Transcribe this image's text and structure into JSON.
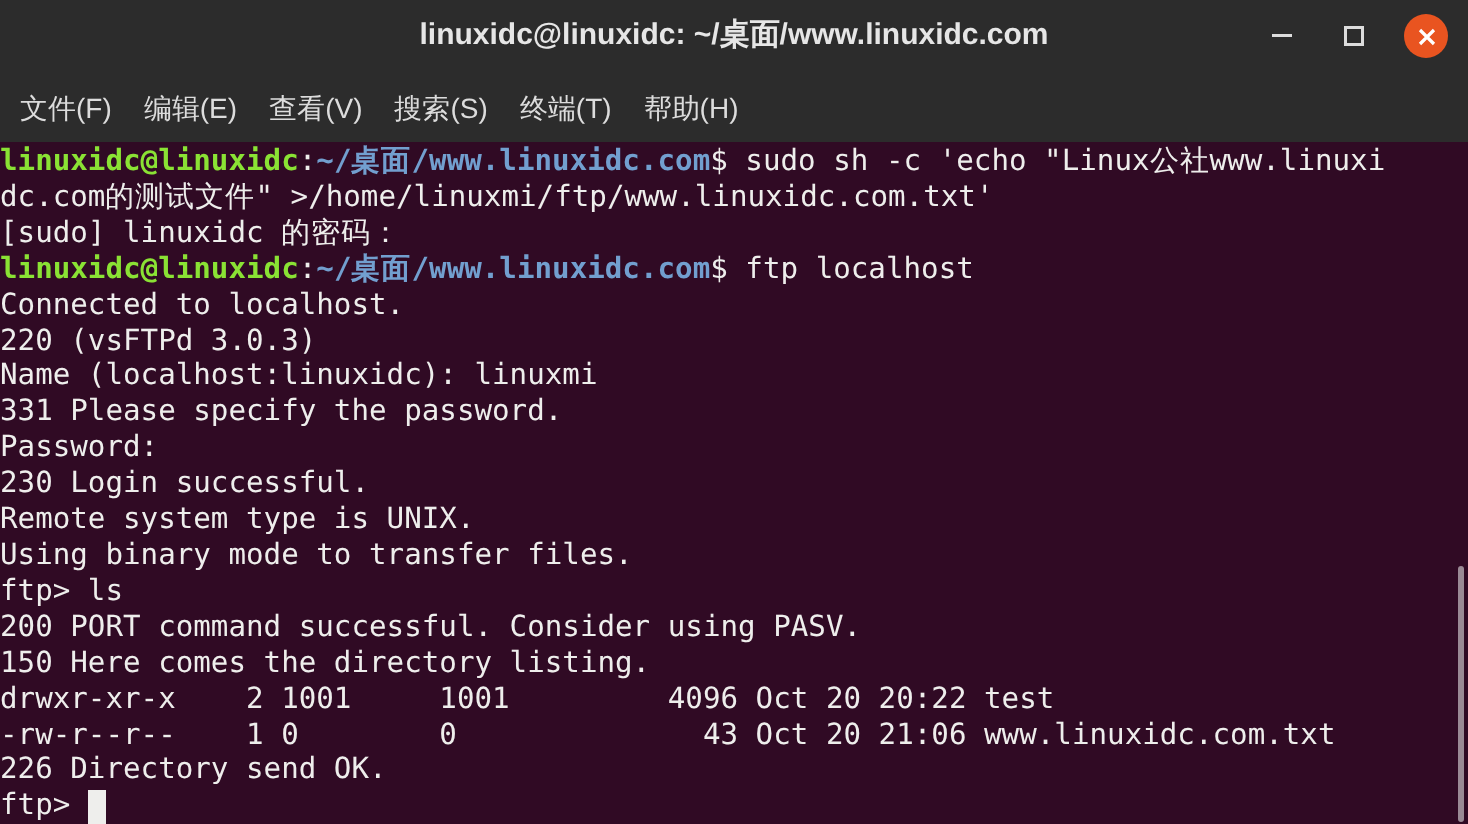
{
  "window": {
    "title": "linuxidc@linuxidc: ~/桌面/www.linuxidc.com"
  },
  "menu": [
    "文件(F)",
    "编辑(E)",
    "查看(V)",
    "搜索(S)",
    "终端(T)",
    "帮助(H)"
  ],
  "terminal": {
    "lines": [
      {
        "kind": "prompt",
        "user": "linuxidc@linuxidc",
        "separator": ":",
        "path": "~/桌面/www.linuxidc.com",
        "command": "$ sudo sh -c 'echo \"Linux公社www.linuxi"
      },
      {
        "kind": "output",
        "text": "dc.com的测试文件\" >/home/linuxmi/ftp/www.linuxidc.com.txt'"
      },
      {
        "kind": "output",
        "text": "[sudo] linuxidc 的密码："
      },
      {
        "kind": "prompt",
        "user": "linuxidc@linuxidc",
        "separator": ":",
        "path": "~/桌面/www.linuxidc.com",
        "command": "$ ftp localhost"
      },
      {
        "kind": "output",
        "text": "Connected to localhost."
      },
      {
        "kind": "output",
        "text": "220 (vsFTPd 3.0.3)"
      },
      {
        "kind": "output",
        "text": "Name (localhost:linuxidc): linuxmi"
      },
      {
        "kind": "output",
        "text": "331 Please specify the password."
      },
      {
        "kind": "output",
        "text": "Password:"
      },
      {
        "kind": "output",
        "text": "230 Login successful."
      },
      {
        "kind": "output",
        "text": "Remote system type is UNIX."
      },
      {
        "kind": "output",
        "text": "Using binary mode to transfer files."
      },
      {
        "kind": "output",
        "text": "ftp> ls"
      },
      {
        "kind": "output",
        "text": "200 PORT command successful. Consider using PASV."
      },
      {
        "kind": "output",
        "text": "150 Here comes the directory listing."
      },
      {
        "kind": "output",
        "text": "drwxr-xr-x    2 1001     1001         4096 Oct 20 20:22 test"
      },
      {
        "kind": "output",
        "text": "-rw-r--r--    1 0        0              43 Oct 20 21:06 www.linuxidc.com.txt"
      },
      {
        "kind": "output",
        "text": "226 Directory send OK."
      },
      {
        "kind": "input",
        "text": "ftp>"
      }
    ]
  }
}
